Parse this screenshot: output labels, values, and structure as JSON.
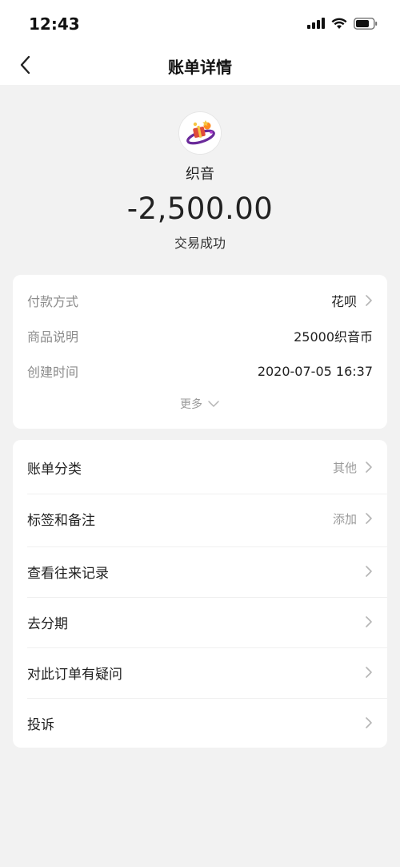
{
  "status_bar": {
    "time": "12:43"
  },
  "nav": {
    "title": "账单详情"
  },
  "merchant": {
    "name": "织音",
    "amount": "-2,500.00",
    "status": "交易成功"
  },
  "details": [
    {
      "label": "付款方式",
      "value": "花呗",
      "has_arrow": true
    },
    {
      "label": "商品说明",
      "value": "25000织音币",
      "has_arrow": false
    },
    {
      "label": "创建时间",
      "value": "2020-07-05 16:37",
      "has_arrow": false
    }
  ],
  "more_label": "更多",
  "menu": [
    {
      "label": "账单分类",
      "value": "其他"
    },
    {
      "label": "标签和备注",
      "value": "添加"
    },
    {
      "label": "查看往来记录",
      "value": ""
    },
    {
      "label": "去分期",
      "value": ""
    },
    {
      "label": "对此订单有疑问",
      "value": ""
    },
    {
      "label": "投诉",
      "value": ""
    }
  ],
  "icons": {
    "back": "chevron-left-icon",
    "arrow": "chevron-right-icon",
    "expand": "chevron-down-icon",
    "signal": "signal-icon",
    "wifi": "wifi-icon",
    "battery": "battery-icon"
  },
  "colors": {
    "background": "#f2f2f2",
    "card": "#ffffff",
    "label_gray": "#8c8c8c",
    "text": "#1f1f1f"
  }
}
